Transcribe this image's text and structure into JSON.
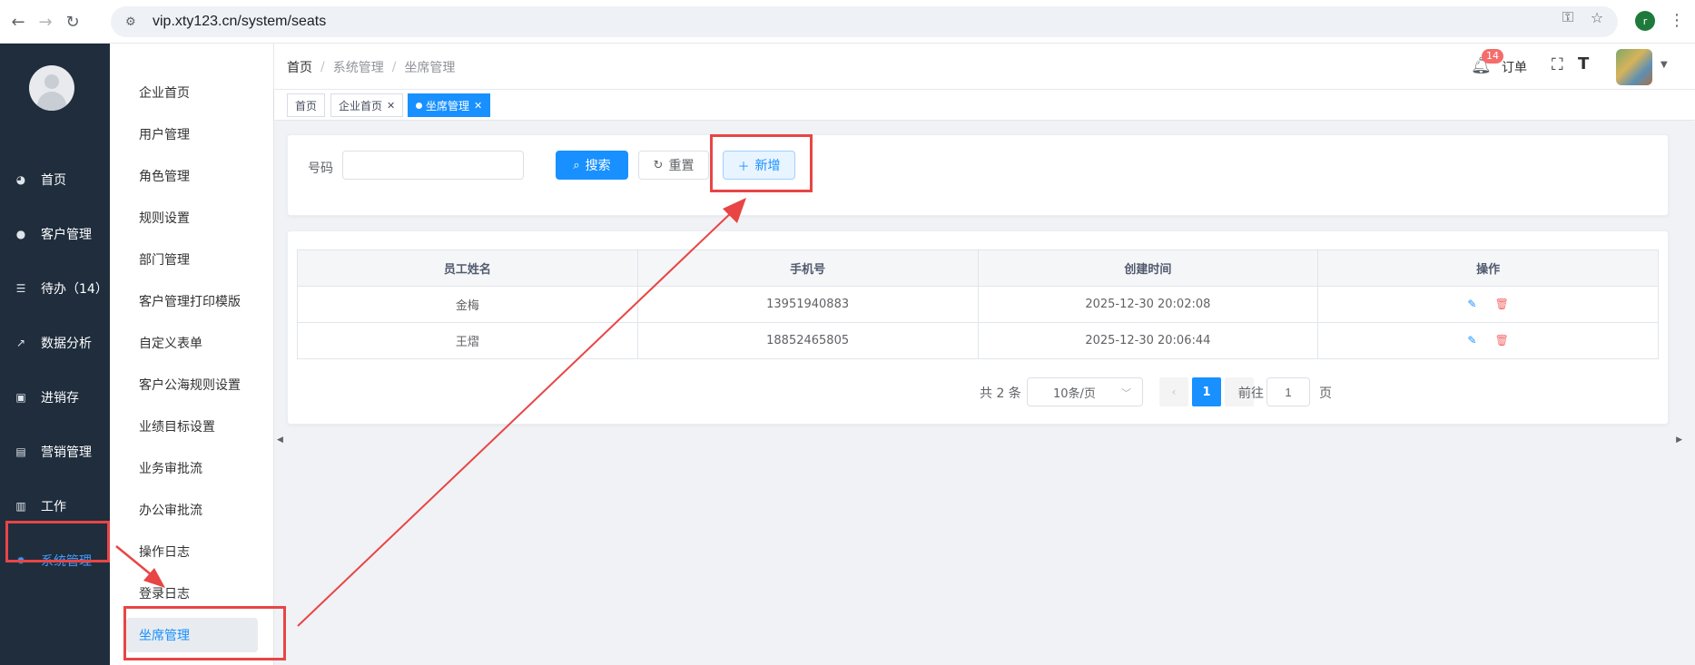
{
  "browser": {
    "url": "vip.xty123.cn/system/seats",
    "profile_initial": "r"
  },
  "sidebar": {
    "items": [
      {
        "label": "首页",
        "icon": "dashboard-icon"
      },
      {
        "label": "客户管理",
        "icon": "user-icon"
      },
      {
        "label": "待办（14）",
        "icon": "sliders-icon"
      },
      {
        "label": "数据分析",
        "icon": "chart-icon"
      },
      {
        "label": "进销存",
        "icon": "window-icon"
      },
      {
        "label": "营销管理",
        "icon": "marketing-icon"
      },
      {
        "label": "工作",
        "icon": "book-icon"
      },
      {
        "label": "系统管理",
        "icon": "gear-icon"
      }
    ]
  },
  "submenu": {
    "items": [
      "企业首页",
      "用户管理",
      "角色管理",
      "规则设置",
      "部门管理",
      "客户管理打印模版",
      "自定义表单",
      "客户公海规则设置",
      "业绩目标设置",
      "业务审批流",
      "办公审批流",
      "操作日志",
      "登录日志",
      "坐席管理"
    ]
  },
  "header": {
    "breadcrumb": [
      "首页",
      "系统管理",
      "坐席管理"
    ],
    "breadcrumb_sep": "/",
    "bell_badge": "14",
    "order_label": "订单"
  },
  "tags": [
    {
      "label": "首页"
    },
    {
      "label": "企业首页"
    },
    {
      "label": "坐席管理"
    }
  ],
  "search": {
    "phone_label": "号码",
    "phone_value": "",
    "search_label": "搜索",
    "reset_label": "重置",
    "add_label": "新增"
  },
  "table": {
    "columns": [
      "员工姓名",
      "手机号",
      "创建时间",
      "操作"
    ],
    "rows": [
      {
        "name": "金梅",
        "phone": "13951940883",
        "created": "2025-12-30 20:02:08"
      },
      {
        "name": "王熠",
        "phone": "18852465805",
        "created": "2025-12-30 20:06:44"
      }
    ]
  },
  "pagination": {
    "total": "共 2 条",
    "page_size": "10条/页",
    "current_page": "1",
    "goto_label": "前往",
    "goto_value": "1",
    "goto_suffix": "页"
  },
  "colors": {
    "primary": "#1890ff",
    "sidebar_bg": "#1f2d3d",
    "annotation_red": "#e84545",
    "danger": "#f56c6c"
  }
}
